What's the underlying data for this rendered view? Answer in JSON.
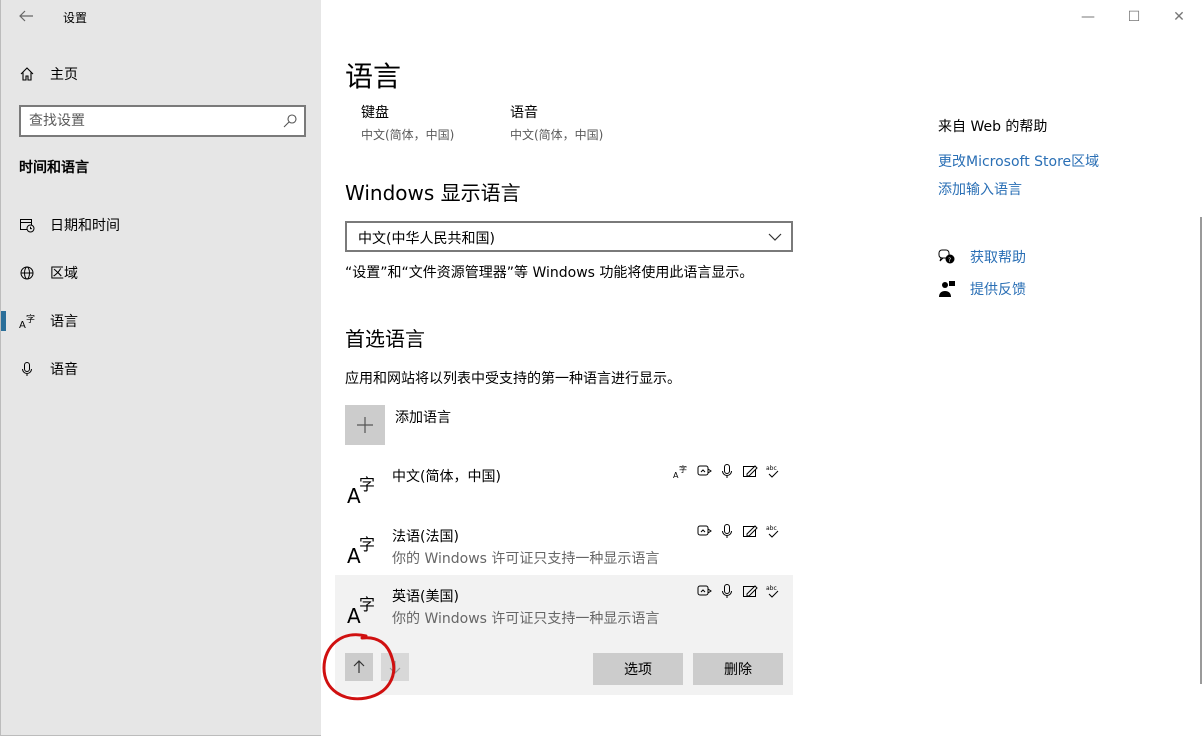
{
  "window": {
    "app_title": "设置",
    "minimize": "—",
    "maximize": "☐",
    "close": "✕"
  },
  "sidebar": {
    "home_label": "主页",
    "search_placeholder": "查找设置",
    "section_title": "时间和语言",
    "items": [
      {
        "label": "日期和时间",
        "icon": "calendar-clock-icon",
        "active": false
      },
      {
        "label": "区域",
        "icon": "globe-icon",
        "active": false
      },
      {
        "label": "语言",
        "icon": "language-icon",
        "active": true
      },
      {
        "label": "语音",
        "icon": "microphone-icon",
        "active": false
      }
    ]
  },
  "main": {
    "title": "语言",
    "features": [
      {
        "title": "键盘",
        "subtitle": "中文(简体，中国)"
      },
      {
        "title": "语音",
        "subtitle": "中文(简体，中国)"
      }
    ],
    "display_language": {
      "heading": "Windows 显示语言",
      "selected": "中文(中华人民共和国)",
      "description": "“设置”和“文件资源管理器”等 Windows 功能将使用此语言显示。"
    },
    "preferred": {
      "heading": "首选语言",
      "description": "应用和网站将以列表中受支持的第一种语言进行显示。",
      "add_label": "添加语言",
      "languages": [
        {
          "name": "中文(简体，中国)",
          "note": ""
        },
        {
          "name": "法语(法国)",
          "note": "你的 Windows 许可证只支持一种显示语言"
        },
        {
          "name": "英语(美国)",
          "note": "你的 Windows 许可证只支持一种显示语言"
        }
      ],
      "options_label": "选项",
      "remove_label": "删除"
    }
  },
  "help": {
    "title": "来自 Web 的帮助",
    "links": [
      "更改Microsoft Store区域",
      "添加输入语言"
    ],
    "get_help": "获取帮助",
    "feedback": "提供反馈"
  },
  "colors": {
    "sidebar_bg": "#e6e6e6",
    "accent": "#2b6f9a",
    "link": "#2a6fb5",
    "annotation": "#d01010"
  }
}
